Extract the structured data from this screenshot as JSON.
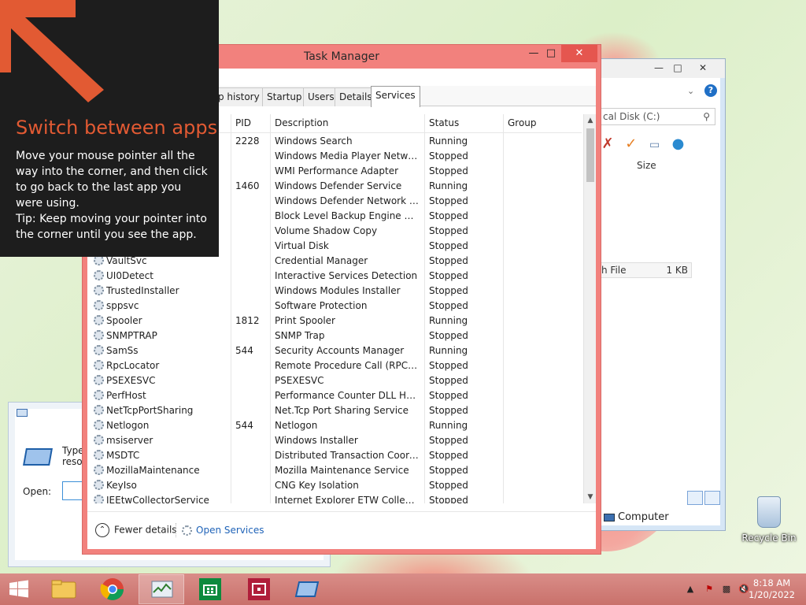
{
  "tip": {
    "title": "Switch between apps",
    "body_line1": "Move your mouse pointer all the way into the corner, and then click to go back to the last app you were using.",
    "body_line2": "Tip: Keep moving your pointer into the corner until you see the app.",
    "accent_color": "#e25a33"
  },
  "explorer": {
    "address": "cal Disk (C:)",
    "column_size": "Size",
    "file_name": "h File",
    "file_size": "1 KB",
    "computer_label": "Computer",
    "help_icon": "help-icon"
  },
  "recycle_bin": {
    "label": "Recycle Bin"
  },
  "run_dialog": {
    "type_text": "Type resou",
    "open_label": "Open:"
  },
  "task_manager": {
    "title": "Task Manager",
    "accent_color": "#f2817d",
    "tabs": [
      {
        "label": "p history"
      },
      {
        "label": "Startup"
      },
      {
        "label": "Users"
      },
      {
        "label": "Details"
      },
      {
        "label": "Services",
        "active": true
      }
    ],
    "columns": {
      "pid": "PID",
      "description": "Description",
      "status": "Status",
      "group": "Group"
    },
    "services": [
      {
        "name": "",
        "pid": "2228",
        "description": "Windows Search",
        "status": "Running"
      },
      {
        "name": "",
        "pid": "",
        "description": "Windows Media Player Network ...",
        "status": "Stopped"
      },
      {
        "name": "",
        "pid": "",
        "description": "WMI Performance Adapter",
        "status": "Stopped"
      },
      {
        "name": "",
        "pid": "1460",
        "description": "Windows Defender Service",
        "status": "Running"
      },
      {
        "name": "",
        "pid": "",
        "description": "Windows Defender Network Insp...",
        "status": "Stopped"
      },
      {
        "name": "",
        "pid": "",
        "description": "Block Level Backup Engine Service",
        "status": "Stopped"
      },
      {
        "name": "",
        "pid": "",
        "description": "Volume Shadow Copy",
        "status": "Stopped"
      },
      {
        "name": "",
        "pid": "",
        "description": "Virtual Disk",
        "status": "Stopped"
      },
      {
        "name": "VaultSvc",
        "pid": "",
        "description": "Credential Manager",
        "status": "Stopped"
      },
      {
        "name": "UI0Detect",
        "pid": "",
        "description": "Interactive Services Detection",
        "status": "Stopped"
      },
      {
        "name": "TrustedInstaller",
        "pid": "",
        "description": "Windows Modules Installer",
        "status": "Stopped"
      },
      {
        "name": "sppsvc",
        "pid": "",
        "description": "Software Protection",
        "status": "Stopped"
      },
      {
        "name": "Spooler",
        "pid": "1812",
        "description": "Print Spooler",
        "status": "Running"
      },
      {
        "name": "SNMPTRAP",
        "pid": "",
        "description": "SNMP Trap",
        "status": "Stopped"
      },
      {
        "name": "SamSs",
        "pid": "544",
        "description": "Security Accounts Manager",
        "status": "Running"
      },
      {
        "name": "RpcLocator",
        "pid": "",
        "description": "Remote Procedure Call (RPC) Lo...",
        "status": "Stopped"
      },
      {
        "name": "PSEXESVC",
        "pid": "",
        "description": "PSEXESVC",
        "status": "Stopped"
      },
      {
        "name": "PerfHost",
        "pid": "",
        "description": "Performance Counter DLL Host",
        "status": "Stopped"
      },
      {
        "name": "NetTcpPortSharing",
        "pid": "",
        "description": "Net.Tcp Port Sharing Service",
        "status": "Stopped"
      },
      {
        "name": "Netlogon",
        "pid": "544",
        "description": "Netlogon",
        "status": "Running"
      },
      {
        "name": "msiserver",
        "pid": "",
        "description": "Windows Installer",
        "status": "Stopped"
      },
      {
        "name": "MSDTC",
        "pid": "",
        "description": "Distributed Transaction Coordin...",
        "status": "Stopped"
      },
      {
        "name": "MozillaMaintenance",
        "pid": "",
        "description": "Mozilla Maintenance Service",
        "status": "Stopped"
      },
      {
        "name": "KeyIso",
        "pid": "",
        "description": "CNG Key Isolation",
        "status": "Stopped"
      },
      {
        "name": "IEEtwCollectorService",
        "pid": "",
        "description": "Internet Explorer ETW Collector S...",
        "status": "Stopped"
      }
    ],
    "footer": {
      "fewer_details": "Fewer details",
      "open_services": "Open Services"
    }
  },
  "taskbar": {
    "time": "8:18 AM",
    "date": "1/20/2022",
    "color": "#c9716b",
    "pinned": [
      {
        "name": "file-explorer-icon"
      },
      {
        "name": "chrome-icon"
      },
      {
        "name": "task-manager-icon",
        "active": true
      },
      {
        "name": "store-icon"
      },
      {
        "name": "media-app-icon"
      },
      {
        "name": "run-icon"
      }
    ]
  }
}
